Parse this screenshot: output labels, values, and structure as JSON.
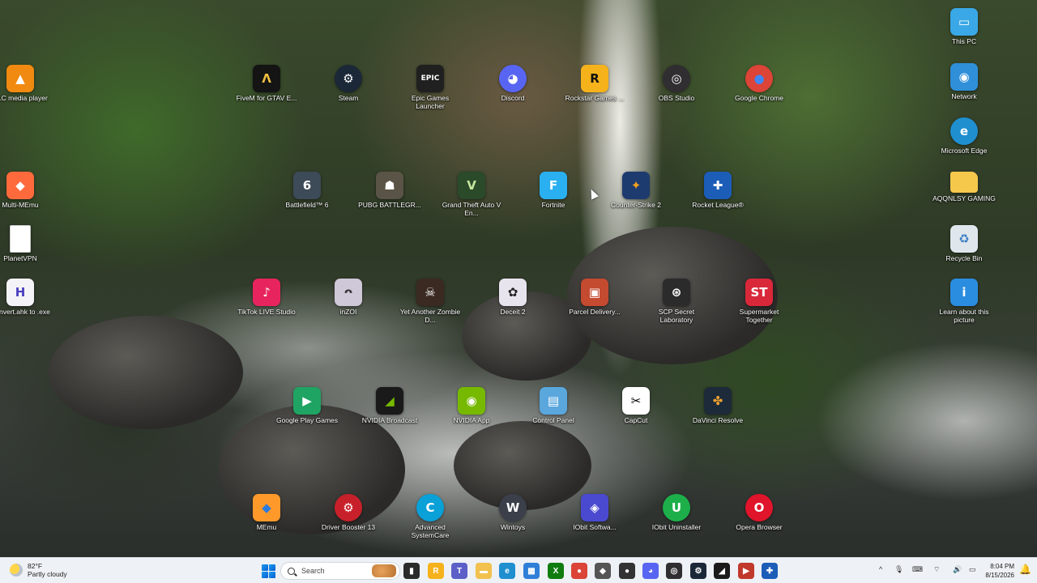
{
  "desktop": {
    "icons": [
      {
        "label": "VLC media player",
        "icon": "vlc-icon",
        "glyph": "▲",
        "bg": "#f08a10",
        "fg": "#ffffff"
      },
      {
        "label": "Multi-MEmu",
        "icon": "multi-memu-icon",
        "glyph": "◆",
        "bg": "#ff6a3d",
        "fg": "#ffffff"
      },
      {
        "label": "PlanetVPN",
        "icon": "file-icon",
        "glyph": "",
        "bg": "#ffffff",
        "fg": "#333333"
      },
      {
        "label": "Convert.ahk to .exe",
        "icon": "ahk-icon",
        "glyph": "H",
        "bg": "#f4f4f8",
        "fg": "#4a3fc0"
      },
      {
        "label": "This PC",
        "icon": "this-pc-icon",
        "glyph": "▭",
        "bg": "#3aa8e6",
        "fg": "#ffffff"
      },
      {
        "label": "Network",
        "icon": "network-icon",
        "glyph": "◉",
        "bg": "#2f8fd8",
        "fg": "#ffffff"
      },
      {
        "label": "Microsoft Edge",
        "icon": "edge-icon",
        "glyph": "e",
        "bg": "#1f8fd0",
        "fg": "#ffffff"
      },
      {
        "label": "AQQNLSY GAMING",
        "icon": "folder-icon",
        "glyph": "",
        "bg": "#f5c84c",
        "fg": "#ffffff"
      },
      {
        "label": "Recycle Bin",
        "icon": "recycle-bin-icon",
        "glyph": "♻",
        "bg": "#dfe6ec",
        "fg": "#3a7fc0"
      },
      {
        "label": "Learn about this picture",
        "icon": "learn-picture-icon",
        "glyph": "i",
        "bg": "#2b8de0",
        "fg": "#ffffff"
      },
      {
        "label": "FiveM for GTAV E...",
        "icon": "fivem-icon",
        "glyph": "Λ",
        "bg": "#141414",
        "fg": "#f0c040"
      },
      {
        "label": "Steam",
        "icon": "steam-icon",
        "glyph": "⚙",
        "bg": "#1b2838",
        "fg": "#ffffff"
      },
      {
        "label": "Epic Games Launcher",
        "icon": "epic-games-icon",
        "glyph": "EPIC",
        "bg": "#202020",
        "fg": "#ffffff"
      },
      {
        "label": "Discord",
        "icon": "discord-icon",
        "glyph": "◕",
        "bg": "#5865f2",
        "fg": "#ffffff"
      },
      {
        "label": "Rockstar Games ...",
        "icon": "rockstar-icon",
        "glyph": "R",
        "bg": "#f6b21b",
        "fg": "#111111"
      },
      {
        "label": "OBS Studio",
        "icon": "obs-icon",
        "glyph": "◎",
        "bg": "#302e31",
        "fg": "#ffffff"
      },
      {
        "label": "Google Chrome",
        "icon": "chrome-icon",
        "glyph": "●",
        "bg": "#db4437",
        "fg": "#4285f4"
      },
      {
        "label": "Battlefield™ 6",
        "icon": "battlefield-icon",
        "glyph": "6",
        "bg": "#3d4a58",
        "fg": "#ffffff"
      },
      {
        "label": "PUBG BATTLEGR...",
        "icon": "pubg-icon",
        "glyph": "☗",
        "bg": "#5a5446",
        "fg": "#ffffff"
      },
      {
        "label": "Grand Theft Auto V En...",
        "icon": "gta-icon",
        "glyph": "V",
        "bg": "#2b4a2a",
        "fg": "#c8e6a0"
      },
      {
        "label": "Fortnite",
        "icon": "fortnite-icon",
        "glyph": "F",
        "bg": "#2ab0f0",
        "fg": "#ffffff"
      },
      {
        "label": "Counter-Strike 2",
        "icon": "counter-strike-icon",
        "glyph": "✦",
        "bg": "#1d3b6e",
        "fg": "#f0a020"
      },
      {
        "label": "Rocket League®",
        "icon": "rocket-league-icon",
        "glyph": "✚",
        "bg": "#1c5db8",
        "fg": "#ffffff"
      },
      {
        "label": "TikTok LIVE Studio",
        "icon": "tiktok-icon",
        "glyph": "♪",
        "bg": "#e8245e",
        "fg": "#ffffff"
      },
      {
        "label": "inZOI",
        "icon": "inzoi-icon",
        "glyph": "ᴖ",
        "bg": "#cfc8d8",
        "fg": "#333333"
      },
      {
        "label": "Yet Another Zombie D...",
        "icon": "zombie-game-icon",
        "glyph": "☠",
        "bg": "#3a2a22",
        "fg": "#ffffff"
      },
      {
        "label": "Deceit 2",
        "icon": "deceit-icon",
        "glyph": "✿",
        "bg": "#e8e4ee",
        "fg": "#222222"
      },
      {
        "label": "Parcel Delivery...",
        "icon": "parcel-delivery-icon",
        "glyph": "▣",
        "bg": "#c44a30",
        "fg": "#ffffff"
      },
      {
        "label": "SCP Secret Laboratory",
        "icon": "scp-icon",
        "glyph": "⊛",
        "bg": "#2b2b2b",
        "fg": "#ffffff"
      },
      {
        "label": "Supermarket Together",
        "icon": "supermarket-icon",
        "glyph": "ST",
        "bg": "#d9283a",
        "fg": "#ffffff"
      },
      {
        "label": "Google Play Games",
        "icon": "google-play-games-icon",
        "glyph": "▶",
        "bg": "#1fa463",
        "fg": "#ffffff"
      },
      {
        "label": "NVIDIA Broadcast",
        "icon": "nvidia-broadcast-icon",
        "glyph": "◢",
        "bg": "#1a1a1a",
        "fg": "#76b900"
      },
      {
        "label": "NVIDIA App",
        "icon": "nvidia-app-icon",
        "glyph": "◉",
        "bg": "#76b900",
        "fg": "#ffffff"
      },
      {
        "label": "Control Panel",
        "icon": "control-panel-icon",
        "glyph": "▤",
        "bg": "#5aa7dd",
        "fg": "#ffffff"
      },
      {
        "label": "CapCut",
        "icon": "capcut-icon",
        "glyph": "✂",
        "bg": "#ffffff",
        "fg": "#000000"
      },
      {
        "label": "DaVinci Resolve",
        "icon": "davinci-icon",
        "glyph": "✤",
        "bg": "#1c2a3a",
        "fg": "#f0a030"
      },
      {
        "label": "MEmu",
        "icon": "memu-icon",
        "glyph": "◆",
        "bg": "#ff9a2a",
        "fg": "#2c7ae0"
      },
      {
        "label": "Driver Booster 13",
        "icon": "driver-booster-icon",
        "glyph": "⚙",
        "bg": "#c8202a",
        "fg": "#ffffff"
      },
      {
        "label": "Advanced SystemCare",
        "icon": "advanced-systemcare-icon",
        "glyph": "C",
        "bg": "#0aa0d8",
        "fg": "#ffffff"
      },
      {
        "label": "Wintoys",
        "icon": "wintoys-icon",
        "glyph": "W",
        "bg": "#3a3f4a",
        "fg": "#ffffff"
      },
      {
        "label": "IObit Softwa...",
        "icon": "iobit-software-icon",
        "glyph": "◈",
        "bg": "#4a4ad0",
        "fg": "#ffffff"
      },
      {
        "label": "IObit Uninstaller",
        "icon": "iobit-uninstaller-icon",
        "glyph": "U",
        "bg": "#1db04a",
        "fg": "#ffffff"
      },
      {
        "label": "Opera Browser",
        "icon": "opera-icon",
        "glyph": "O",
        "bg": "#e0142b",
        "fg": "#ffffff"
      }
    ]
  },
  "taskbar": {
    "weather": {
      "temp": "82°F",
      "condition": "Partly cloudy"
    },
    "search_placeholder": "Search",
    "pinned": [
      {
        "icon": "file-explorer-pinned-icon",
        "glyph": "▮",
        "bg": "#2b2b2b"
      },
      {
        "icon": "rockstar-pinned-icon",
        "glyph": "R",
        "bg": "#f6b21b"
      },
      {
        "icon": "teams-pinned-icon",
        "glyph": "T",
        "bg": "#5b5fc7"
      },
      {
        "icon": "folder-pinned-icon",
        "glyph": "▬",
        "bg": "#f2c14e"
      },
      {
        "icon": "edge-pinned-icon",
        "glyph": "e",
        "bg": "#1f8fd0"
      },
      {
        "icon": "store-pinned-icon",
        "glyph": "▦",
        "bg": "#2f7fd8"
      },
      {
        "icon": "xbox-pinned-icon",
        "glyph": "X",
        "bg": "#107c10"
      },
      {
        "icon": "chrome-pinned-icon",
        "glyph": "●",
        "bg": "#db4437"
      },
      {
        "icon": "epic-pinned-icon",
        "glyph": "◆",
        "bg": "#555555"
      },
      {
        "icon": "app-pinned-icon",
        "glyph": "●",
        "bg": "#333333"
      },
      {
        "icon": "discord-pinned-icon",
        "glyph": "◕",
        "bg": "#5865f2"
      },
      {
        "icon": "obs-pinned-icon",
        "glyph": "◎",
        "bg": "#302e31"
      },
      {
        "icon": "steam-pinned-icon",
        "glyph": "⚙",
        "bg": "#1b2838"
      },
      {
        "icon": "nvidia-pinned-icon",
        "glyph": "◢",
        "bg": "#1a1a1a"
      },
      {
        "icon": "video-pinned-icon",
        "glyph": "▶",
        "bg": "#c0392b"
      },
      {
        "icon": "rocket-league-pinned-icon",
        "glyph": "✚",
        "bg": "#1c5db8"
      }
    ],
    "tray": {
      "chevron": "^",
      "mic": "🎙",
      "keyboard": "⌨",
      "network": "⌔",
      "volume": "🔊",
      "battery": "▭"
    },
    "time": "8:04 PM",
    "date": "8/15/2026"
  }
}
